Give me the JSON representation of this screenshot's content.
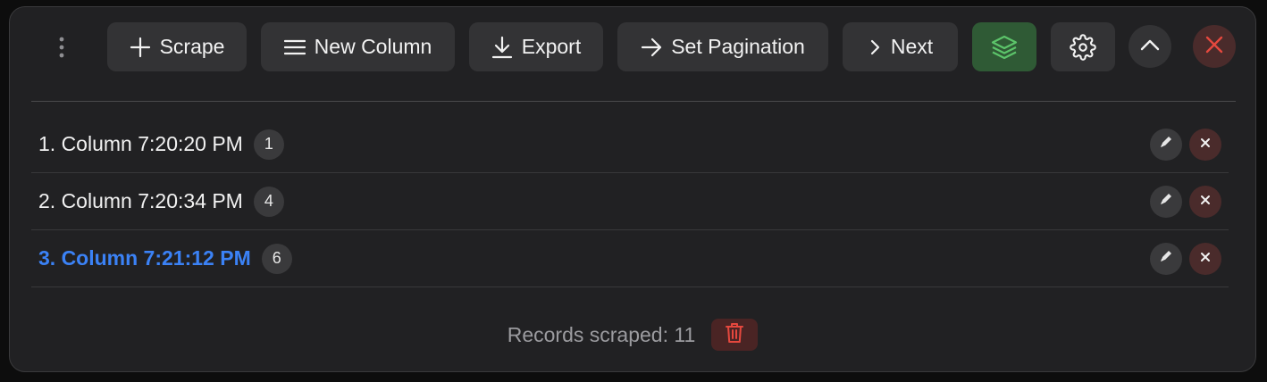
{
  "toolbar": {
    "more_icon": "more-vertical-icon",
    "buttons": [
      {
        "label": "Scrape",
        "icon": "plus-icon"
      },
      {
        "label": "New Column",
        "icon": "menu-lines-icon"
      },
      {
        "label": "Export",
        "icon": "download-icon"
      },
      {
        "label": "Set Pagination",
        "icon": "arrow-right-icon"
      },
      {
        "label": "Next",
        "icon": "chevron-right-icon"
      }
    ],
    "layers_icon": "layers-icon",
    "settings_icon": "gear-icon",
    "collapse_icon": "chevron-up-icon",
    "close_icon": "close-icon"
  },
  "columns": [
    {
      "label": "1. Column 7:20:20 PM",
      "count": "1",
      "active": false
    },
    {
      "label": "2. Column 7:20:34 PM",
      "count": "4",
      "active": false
    },
    {
      "label": "3. Column 7:21:12 PM",
      "count": "6",
      "active": true
    }
  ],
  "footer": {
    "records_label": "Records scraped: 11",
    "clear_icon": "trash-icon"
  },
  "colors": {
    "panel_bg": "#212123",
    "button_bg": "#333335",
    "active_accent": "#3b82f6",
    "layers_bg": "#2f5a35",
    "layers_icon": "#5cc46a",
    "danger": "#e5483e",
    "danger_bg": "#4a2b2b"
  }
}
